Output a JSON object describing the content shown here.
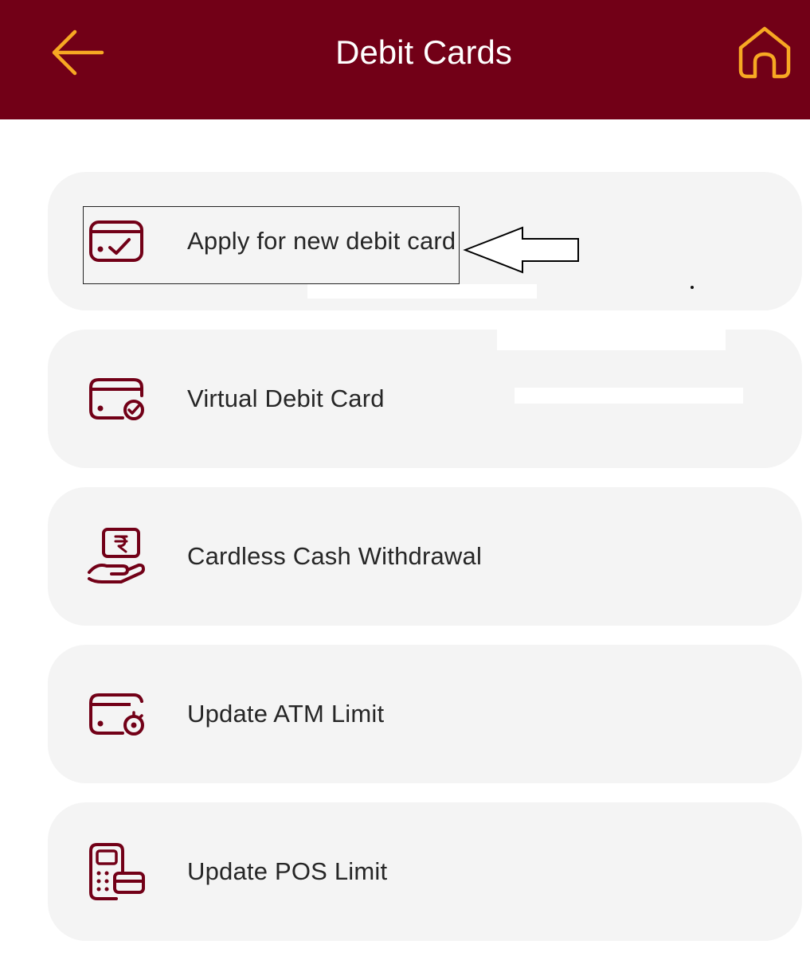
{
  "header": {
    "title": "Debit Cards",
    "background_color": "#720017",
    "icon_color": "#f7a823",
    "back_icon": "back-arrow-icon",
    "home_icon": "home-icon"
  },
  "menu": {
    "icon_color": "#720017",
    "item_background": "#f4f4f4",
    "items": [
      {
        "label": "Apply for new debit card",
        "icon": "debit-card-check-icon"
      },
      {
        "label": "Virtual Debit Card",
        "icon": "virtual-card-check-icon"
      },
      {
        "label": "Cardless Cash Withdrawal",
        "icon": "cash-in-hand-icon"
      },
      {
        "label": "Update ATM Limit",
        "icon": "card-limit-icon"
      },
      {
        "label": "Update POS Limit",
        "icon": "pos-terminal-icon"
      }
    ]
  },
  "annotation": {
    "highlight": "box around Apply for new debit card",
    "arrow": "pointer-arrow-icon"
  }
}
